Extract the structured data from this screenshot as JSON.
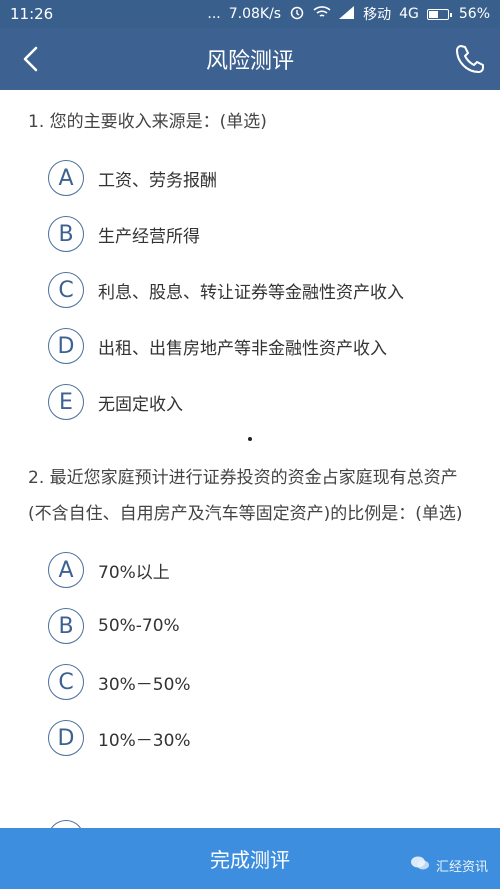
{
  "status_bar": {
    "time": "11:26",
    "dots": "...",
    "network_speed": "7.08K/s",
    "carrier": "移动",
    "network_type": "4G",
    "battery_percent": "56%",
    "battery_level": 0.56
  },
  "header": {
    "title": "风险测评",
    "back_icon": "chevron-left-icon",
    "phone_icon": "phone-icon"
  },
  "questions": [
    {
      "text": "1. 您的主要收入来源是：(单选)",
      "options": [
        {
          "letter": "A",
          "label": "工资、劳务报酬"
        },
        {
          "letter": "B",
          "label": "生产经营所得"
        },
        {
          "letter": "C",
          "label": "利息、股息、转让证券等金融性资产收入"
        },
        {
          "letter": "D",
          "label": "出租、出售房地产等非金融性资产收入"
        },
        {
          "letter": "E",
          "label": "无固定收入"
        }
      ]
    },
    {
      "text": "2. 最近您家庭预计进行证券投资的资金占家庭现有总资产(不含自住、自用房产及汽车等固定资产)的比例是：(单选)",
      "options": [
        {
          "letter": "A",
          "label": "70%以上"
        },
        {
          "letter": "B",
          "label": "50%-70%"
        },
        {
          "letter": "C",
          "label": "30%－50%"
        },
        {
          "letter": "D",
          "label": "10%－30%"
        }
      ]
    }
  ],
  "footer": {
    "button_label": "完成测评",
    "watermark": "汇经资讯"
  },
  "colors": {
    "status_bar": "#395f8d",
    "header": "#3d6291",
    "accent": "#4b6e9b",
    "footer": "#3d8ede"
  }
}
